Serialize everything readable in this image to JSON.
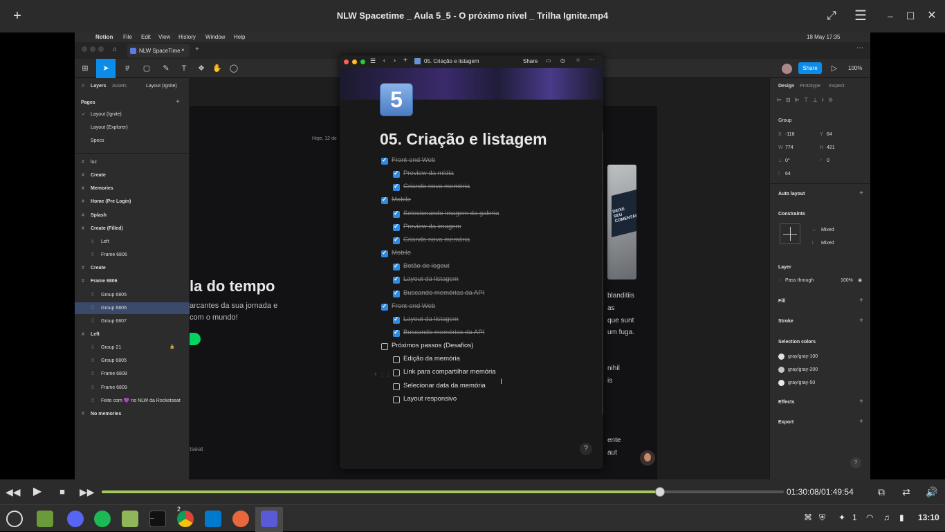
{
  "window": {
    "title": "NLW Spacetime _ Aula 5_5 - O próximo nível _ Trilha Ignite.mp4"
  },
  "mac_menubar": {
    "items": [
      "Notion",
      "File",
      "Edit",
      "View",
      "History",
      "Window",
      "Help"
    ],
    "clock": "18 May  17:35"
  },
  "figma": {
    "tab_title": "NLW SpaceTime",
    "left_tabs": [
      "Layers",
      "Assets"
    ],
    "page_selector": "Layout (Ignite)",
    "pages_heading": "Pages",
    "pages": [
      "Layout (Ignite)",
      "Layout (Explorer)",
      "Specs"
    ],
    "layers": [
      {
        "name": "luz",
        "bold": false,
        "indent": 0
      },
      {
        "name": "Create",
        "bold": true,
        "indent": 0
      },
      {
        "name": "Memories",
        "bold": true,
        "indent": 0
      },
      {
        "name": "Home (Pre Login)",
        "bold": true,
        "indent": 0
      },
      {
        "name": "Splash",
        "bold": true,
        "indent": 0
      },
      {
        "name": "Create (Filled)",
        "bold": true,
        "indent": 0
      },
      {
        "name": "Left",
        "bold": false,
        "indent": 1
      },
      {
        "name": "Frame 6806",
        "bold": false,
        "indent": 1
      },
      {
        "name": "Create",
        "bold": true,
        "indent": 0
      },
      {
        "name": "Frame 6806",
        "bold": true,
        "indent": 0
      },
      {
        "name": "Group 6805",
        "bold": false,
        "indent": 1
      },
      {
        "name": "Group 6806",
        "bold": false,
        "indent": 1
      },
      {
        "name": "Group 6807",
        "bold": false,
        "indent": 1
      },
      {
        "name": "Left",
        "bold": true,
        "indent": 0
      },
      {
        "name": "Group 21",
        "bold": false,
        "indent": 1
      },
      {
        "name": "Group 6805",
        "bold": false,
        "indent": 1
      },
      {
        "name": "Frame 6808",
        "bold": false,
        "indent": 1
      },
      {
        "name": "Frame 6809",
        "bold": false,
        "indent": 1
      },
      {
        "name": "Feito com 💜 no NLW da Rocketseat",
        "bold": false,
        "indent": 1
      },
      {
        "name": "No memories",
        "bold": true,
        "indent": 0
      }
    ],
    "selected_layer": "Group 6806",
    "canvas": {
      "date_text": "Hoje, 12 de",
      "heading": "la do tempo",
      "sub1": "arcantes da sua jornada e",
      "sub2": "com o mundo!",
      "footer": "tseat",
      "right_lines": [
        "blanditiis",
        "as",
        "que sunt",
        "um fuga.",
        "nihil",
        "is",
        "ente",
        "aut"
      ],
      "laptop_text": "DEIXE SEU COMENTÁR"
    },
    "right_tabs": [
      "Design",
      "Prototype",
      "Inspect"
    ],
    "share_label": "Share",
    "zoom": "100%",
    "group_label": "Group",
    "props": {
      "x": "-116",
      "y": "64",
      "w": "774",
      "h": "421",
      "rot": "0°",
      "radius": "0",
      "gap": "64"
    },
    "auto_layout": "Auto layout",
    "constraints": "Constraints",
    "constraint_h": "Mixed",
    "constraint_v": "Mixed",
    "layer_heading": "Layer",
    "blend": "Pass through",
    "opacity": "100%",
    "fill": "Fill",
    "stroke": "Stroke",
    "selection_colors": "Selection colors",
    "colors": [
      {
        "name": "gray/gray-100",
        "hex": "#e1e1e6"
      },
      {
        "name": "gray/gray-200",
        "hex": "#c4c4cc"
      },
      {
        "name": "gray/gray-50",
        "hex": "#eaeaea"
      }
    ],
    "effects": "Effects",
    "export": "Export"
  },
  "notion": {
    "breadcrumb": "05. Criação e listagem",
    "share": "Share",
    "icon_number": "5",
    "title": "05. Criação e listagem",
    "todos": [
      {
        "text": "Front-end Web",
        "checked": true,
        "level": 0
      },
      {
        "text": "Preview da mídia",
        "checked": true,
        "level": 1
      },
      {
        "text": "Criando nova memória",
        "checked": true,
        "level": 1
      },
      {
        "text": "Mobile",
        "checked": true,
        "level": 0
      },
      {
        "text": "Selecionando imagem da galeria",
        "checked": true,
        "level": 1
      },
      {
        "text": "Preview da imagem",
        "checked": true,
        "level": 1
      },
      {
        "text": "Criando nova memória",
        "checked": true,
        "level": 1
      },
      {
        "text": "Mobile",
        "checked": true,
        "level": 0
      },
      {
        "text": "Botão de logout",
        "checked": true,
        "level": 1
      },
      {
        "text": "Layout da listagem",
        "checked": true,
        "level": 1
      },
      {
        "text": "Buscando memórias da API",
        "checked": true,
        "level": 1
      },
      {
        "text": "Front-end Web",
        "checked": true,
        "level": 0
      },
      {
        "text": "Layout da listagem",
        "checked": true,
        "level": 1
      },
      {
        "text": "Buscando memórias da API",
        "checked": true,
        "level": 1
      },
      {
        "text": "Próximos passos (Desafios)",
        "checked": false,
        "level": 0
      },
      {
        "text": "Edição da memória",
        "checked": false,
        "level": 1
      },
      {
        "text": "Link para compartilhar memória",
        "checked": false,
        "level": 1
      },
      {
        "text": "Selecionar data da memória",
        "checked": false,
        "level": 1
      },
      {
        "text": "Layout responsivo",
        "checked": false,
        "level": 1
      }
    ],
    "help": "?"
  },
  "player": {
    "time": "01:30:08/01:49:54",
    "progress": 0.818
  },
  "taskbar": {
    "badge": "2",
    "notif_count": "1",
    "clock": "13:10"
  }
}
